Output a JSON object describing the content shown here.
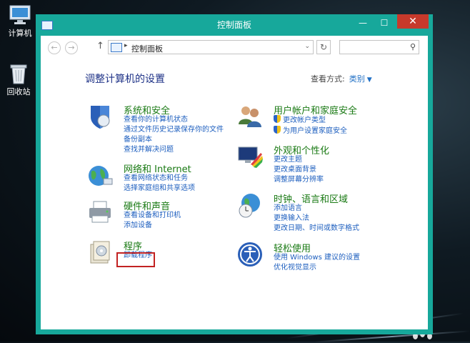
{
  "desktop": {
    "icons": [
      {
        "label": "计算机",
        "icon": "computer-icon"
      },
      {
        "label": "回收站",
        "icon": "recycle-bin-icon"
      }
    ]
  },
  "window": {
    "title": "控制面板",
    "minimize": "—",
    "maximize": "☐",
    "close": "✕"
  },
  "nav": {
    "back": "←",
    "forward": "→",
    "up": "↑",
    "breadcrumb": "控制面板",
    "separator": "▸",
    "dropdown": "⌄",
    "refresh": "↻",
    "search_placeholder": "",
    "search_icon": "⚲"
  },
  "main": {
    "heading": "调整计算机的设置",
    "view_by_label": "查看方式:",
    "view_by_value": "类别",
    "view_by_arrow": "▼",
    "left_categories": [
      {
        "title": "系统和安全",
        "icon": "shield-icon",
        "links": [
          "查看你的计算机状态",
          "通过文件历史记录保存你的文件",
          "备份副本",
          "查找并解决问题"
        ]
      },
      {
        "title": "网络和 Internet",
        "icon": "network-globe-icon",
        "links": [
          "查看网络状态和任务",
          "选择家庭组和共享选项"
        ]
      },
      {
        "title": "硬件和声音",
        "icon": "printer-icon",
        "links": [
          "查看设备和打印机",
          "添加设备"
        ]
      },
      {
        "title": "程序",
        "icon": "programs-icon",
        "links": [
          "卸载程序"
        ]
      }
    ],
    "right_categories": [
      {
        "title": "用户帐户和家庭安全",
        "icon": "users-icon",
        "links": [
          "更改帐户类型",
          "为用户设置家庭安全"
        ],
        "shield_links": true
      },
      {
        "title": "外观和个性化",
        "icon": "appearance-icon",
        "links": [
          "更改主题",
          "更改桌面背景",
          "调整屏幕分辨率"
        ]
      },
      {
        "title": "时钟、语言和区域",
        "icon": "clock-globe-icon",
        "links": [
          "添加语言",
          "更换输入法",
          "更改日期、时间或数字格式"
        ]
      },
      {
        "title": "轻松使用",
        "icon": "ease-of-access-icon",
        "links": [
          "使用 Windows 建议的设置",
          "优化视觉显示"
        ]
      }
    ]
  },
  "colors": {
    "window_frame": "#17a89b",
    "close_button": "#c7392b",
    "category_title": "#1a7a14",
    "link": "#1e5fbf",
    "heading": "#1e3287",
    "highlight_box": "#c22222"
  }
}
